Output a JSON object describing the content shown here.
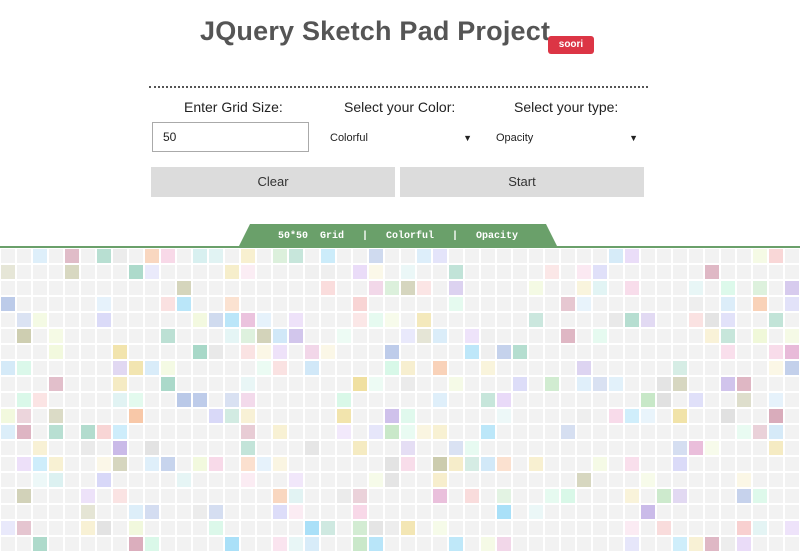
{
  "header": {
    "title": "JQuery Sketch Pad Project",
    "badge": "soori"
  },
  "controls": {
    "grid_size_label": "Enter Grid Size:",
    "color_label": "Select your Color:",
    "type_label": "Select your type:",
    "grid_size_value": "50",
    "color_selected": "Colorful",
    "type_selected": "Opacity",
    "clear_label": "Clear",
    "start_label": "Start"
  },
  "status": {
    "size": "50*50",
    "grid": "Grid",
    "color": "Colorful",
    "type": "Opacity"
  },
  "grid": {
    "columns": 50,
    "base_color": "#f2f2f2",
    "accent_color": "#6aa06a",
    "palette": [
      "#d8d8f8",
      "#f8d8e8",
      "#d8f8e8",
      "#f8f0d0",
      "#d0e8f8",
      "#e8d8f8",
      "#f0f8d8",
      "#f8d0d0",
      "#d8f0f0",
      "#e0e0e0",
      "#c8e8c8",
      "#f8c8a8",
      "#b8c8e8",
      "#e8b8d8",
      "#c8b8e8",
      "#a8d8c8",
      "#f0e0a0",
      "#d8a8b8",
      "#a8e0f8",
      "#c8c8a8"
    ]
  }
}
